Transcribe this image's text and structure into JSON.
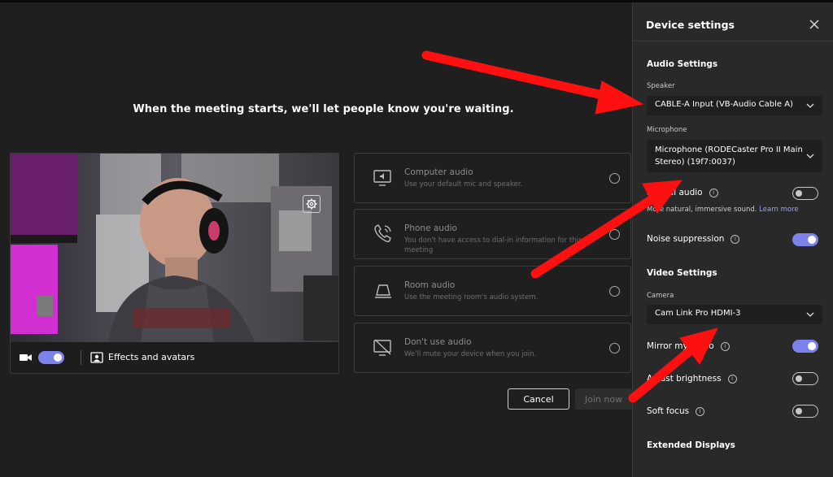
{
  "waiting_message": "When the meeting starts, we'll let people know you're waiting.",
  "preview": {
    "camera_on": true,
    "effects_label": "Effects and avatars"
  },
  "audio_options": [
    {
      "icon": "computer-audio-icon",
      "title": "Computer audio",
      "description": "Use your default mic and speaker."
    },
    {
      "icon": "phone-icon",
      "title": "Phone audio",
      "description": "You don't have access to dial-in information for this meeting"
    },
    {
      "icon": "room-audio-icon",
      "title": "Room audio",
      "description": "Use the meeting room's audio system."
    },
    {
      "icon": "no-audio-icon",
      "title": "Don't use audio",
      "description": "We'll mute your device when you join."
    }
  ],
  "buttons": {
    "cancel": "Cancel",
    "join": "Join now"
  },
  "panel": {
    "title": "Device settings",
    "audio_heading": "Audio Settings",
    "speaker_label": "Speaker",
    "speaker_value": "CABLE-A Input (VB-Audio Cable A)",
    "microphone_label": "Microphone",
    "microphone_value": "Microphone (RODECaster Pro II Main Stereo) (19f7:0037)",
    "spatial_audio_label": "Spatial audio",
    "spatial_audio_on": false,
    "spatial_audio_desc": "More natural, immersive sound.",
    "learn_more": "Learn more",
    "noise_suppression_label": "Noise suppression",
    "noise_suppression_on": true,
    "video_heading": "Video Settings",
    "camera_label": "Camera",
    "camera_value": "Cam Link Pro HDMI-3",
    "mirror_label": "Mirror my video",
    "mirror_on": true,
    "brightness_label": "Adjust brightness",
    "brightness_on": false,
    "soft_focus_label": "Soft focus",
    "soft_focus_on": false,
    "extended_heading": "Extended Displays"
  },
  "colors": {
    "accent": "#7b83eb",
    "annotation_arrow": "#ff0000",
    "panel_bg": "#292929",
    "page_bg": "#1f1f1f"
  }
}
